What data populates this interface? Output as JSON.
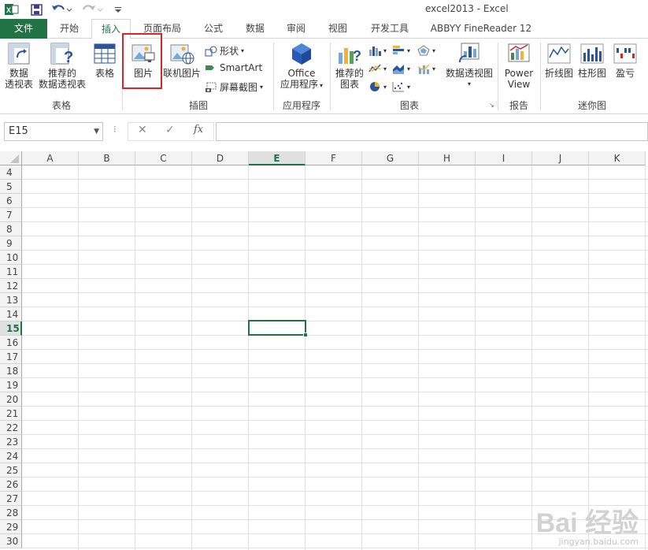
{
  "window": {
    "title": "excel2013 - Excel"
  },
  "quick_access": {
    "excel_icon": "excel-app-icon",
    "save_icon": "save-icon",
    "undo_icon": "undo-icon",
    "redo_icon": "redo-icon",
    "customize_icon": "customize-qat-icon"
  },
  "tabs": [
    {
      "label": "文件"
    },
    {
      "label": "开始"
    },
    {
      "label": "插入"
    },
    {
      "label": "页面布局"
    },
    {
      "label": "公式"
    },
    {
      "label": "数据"
    },
    {
      "label": "审阅"
    },
    {
      "label": "视图"
    },
    {
      "label": "开发工具"
    },
    {
      "label": "ABBYY FineReader 12"
    }
  ],
  "ribbon": {
    "groups": {
      "tables": "表格",
      "illustrations": "插图",
      "apps": "应用程序",
      "charts": "图表",
      "reports": "报告",
      "sparklines": "迷你图"
    },
    "buttons": {
      "pivot_table_l1": "数据",
      "pivot_table_l2": "透视表",
      "recommended_pivot_l1": "推荐的",
      "recommended_pivot_l2": "数据透视表",
      "table": "表格",
      "picture": "图片",
      "online_picture": "联机图片",
      "shapes": "形状",
      "smartart": "SmartArt",
      "screenshot": "屏幕截图",
      "office_apps_l1": "Office",
      "office_apps_l2": "应用程序",
      "recommended_charts_l1": "推荐的",
      "recommended_charts_l2": "图表",
      "pivot_chart": "数据透视图",
      "power_view_l1": "Power",
      "power_view_l2": "View",
      "line_sparkline": "折线图",
      "column_sparkline": "柱形图",
      "winloss_sparkline": "盈亏"
    }
  },
  "formula_bar": {
    "name_box": "E15",
    "fx": "fx",
    "content": ""
  },
  "sheet": {
    "columns": [
      "A",
      "B",
      "C",
      "D",
      "E",
      "F",
      "G",
      "H",
      "I",
      "J",
      "K"
    ],
    "rows": [
      "4",
      "5",
      "6",
      "7",
      "8",
      "9",
      "10",
      "11",
      "12",
      "13",
      "14",
      "15",
      "16",
      "17",
      "18",
      "19",
      "20",
      "21",
      "22",
      "23",
      "24",
      "25",
      "26",
      "27",
      "28",
      "29",
      "30"
    ],
    "selected_column": "E",
    "selected_row": "15"
  },
  "watermark": {
    "brand": "Bai 经验",
    "url": "jingyan.baidu.com"
  },
  "colors": {
    "accent": "#217346",
    "highlight": "#d9252a"
  }
}
